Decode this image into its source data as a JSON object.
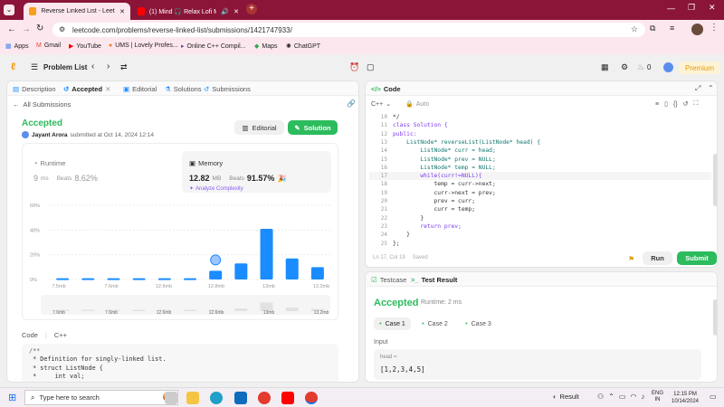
{
  "browser": {
    "tabs": [
      {
        "label": "Reverse Linked List - LeetCode",
        "active": true
      },
      {
        "label": "(1) Mind 🎧 Relax Lofi Music",
        "active": false
      }
    ],
    "url": "leetcode.com/problems/reverse-linked-list/submissions/1421747933/",
    "bookmarks": [
      "Apps",
      "Gmail",
      "YouTube",
      "UMS | Lovely Profes...",
      "Online C++ Compil...",
      "Maps",
      "ChatGPT"
    ]
  },
  "nav": {
    "problem_list": "Problem List",
    "notif_count": "0",
    "premium": "Premium"
  },
  "left": {
    "tabs": [
      "Description",
      "Accepted",
      "Editorial",
      "Solutions",
      "Submissions"
    ],
    "all_submissions": "All Submissions",
    "status": "Accepted",
    "user": "Jayant Arora",
    "submitted": "submitted at Oct 14, 2024 12:14",
    "editorial_btn": "Editorial",
    "solution_btn": "Solution",
    "runtime_label": "Runtime",
    "runtime_value": "9",
    "runtime_unit": "ms",
    "runtime_beats_label": "Beats",
    "runtime_beats": "8.62%",
    "memory_label": "Memory",
    "memory_value": "12.82",
    "memory_unit": "MB",
    "memory_beats_label": "Beats",
    "memory_beats": "91.57%",
    "analyze": "Analyze Complexity",
    "code_label": "Code",
    "code_lang": "C++",
    "code_lines": [
      "/**",
      " * Definition for singly-linked list.",
      " * struct ListNode {",
      " *     int val;"
    ]
  },
  "chart_data": {
    "type": "bar",
    "ylabels": [
      "60%",
      "40%",
      "20%",
      "0%"
    ],
    "ylim": [
      0,
      60
    ],
    "xlabels": [
      "7.5mb",
      "7.6mb",
      "12.6mb",
      "12.8mb",
      "13mb",
      "13.2mb"
    ],
    "values": [
      1,
      1,
      1,
      1,
      1,
      1,
      7,
      13,
      41,
      17,
      10
    ],
    "highlight_index": 6,
    "mini_labels": [
      "7.6mb",
      "7.6mb",
      "12.6mb",
      "12.6mb",
      "13mb",
      "13.2mb"
    ]
  },
  "editor": {
    "title": "Code",
    "lang": "C++",
    "mode": "Auto",
    "start_line": 10,
    "lines": [
      "*/",
      "class Solution {",
      "public:",
      "    ListNode* reverseList(ListNode* head) {",
      "        ListNode* curr = head;",
      "        ListNode* prev = NULL;",
      "        ListNode* temp = NULL;",
      "        while(curr!=NULL){",
      "            temp = curr->next;",
      "            curr->next = prev;",
      "            prev = curr;",
      "            curr = temp;",
      "        }",
      "        return prev;",
      "    }",
      "};"
    ],
    "status": "Ln 17, Col 19",
    "saved": "Saved",
    "run": "Run",
    "submit": "Submit"
  },
  "result": {
    "tab_testcase": "Testcase",
    "tab_result": "Test Result",
    "status": "Accepted",
    "runtime": "Runtime: 2 ms",
    "cases": [
      "Case 1",
      "Case 2",
      "Case 3"
    ],
    "input_label": "Input",
    "var_name": "head =",
    "var_value": "[1,2,3,4,5]"
  },
  "taskbar": {
    "search": "Type here to search",
    "result_label": "Result",
    "lang1": "ENG",
    "lang2": "IN",
    "time": "12:15 PM",
    "date": "10/14/2024"
  }
}
